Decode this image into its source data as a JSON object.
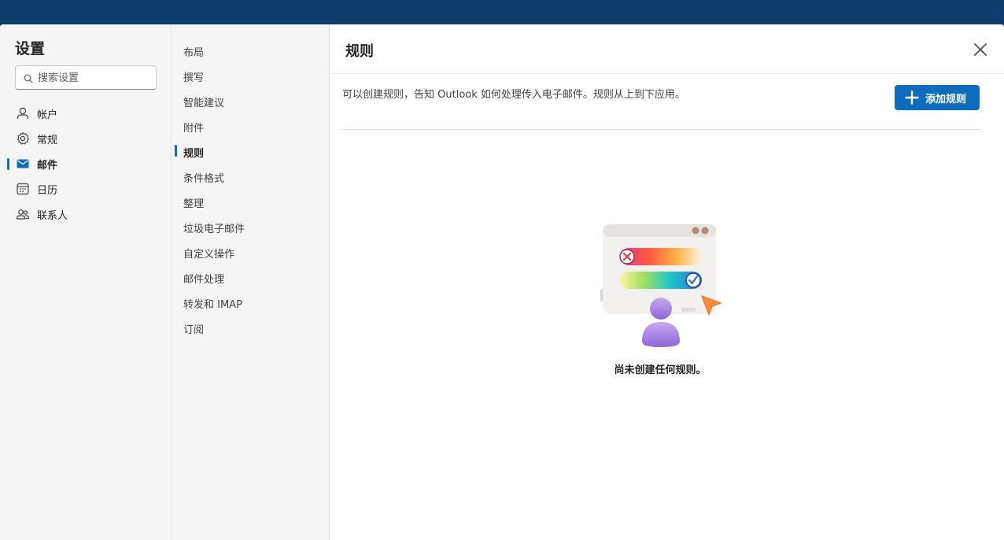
{
  "settings": {
    "title": "设置",
    "search_placeholder": "搜索设置",
    "nav": [
      {
        "label": "帐户",
        "icon": "person-icon"
      },
      {
        "label": "常规",
        "icon": "gear-icon"
      },
      {
        "label": "邮件",
        "icon": "mail-icon",
        "active": true
      },
      {
        "label": "日历",
        "icon": "calendar-icon"
      },
      {
        "label": "联系人",
        "icon": "people-icon"
      }
    ]
  },
  "mail_nav": {
    "items": [
      "布局",
      "撰写",
      "智能建议",
      "附件",
      "规则",
      "条件格式",
      "整理",
      "垃圾电子邮件",
      "自定义操作",
      "邮件处理",
      "转发和 IMAP",
      "订阅"
    ],
    "active": "规则"
  },
  "main": {
    "heading": "规则",
    "description": "可以创建规则，告知 Outlook 如何处理传入电子邮件。规则从上到下应用。",
    "add_button": "添加规则",
    "empty_text": "尚未创建任何规则。",
    "illustration": "rules-empty-illustration",
    "close_icon": "close-icon"
  },
  "colors": {
    "topbar": "#0c3b6c",
    "accent": "#0f6cbd",
    "nav_bg": "#f5f5f5"
  }
}
